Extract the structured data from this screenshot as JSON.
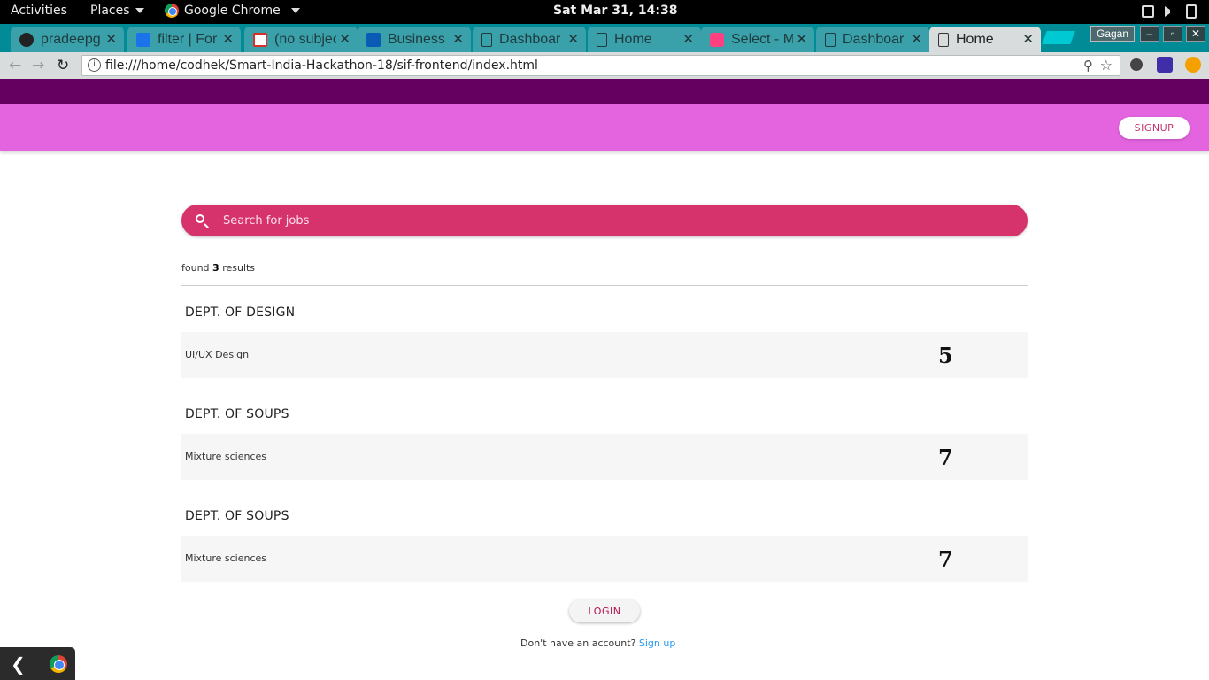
{
  "system_bar": {
    "activities": "Activities",
    "places": "Places",
    "app": "Google Chrome",
    "clock": "Sat Mar 31, 14:38"
  },
  "tabs": [
    {
      "title": "pradeepg",
      "icon": "github-icon"
    },
    {
      "title": "filter | For",
      "icon": "flag-icon"
    },
    {
      "title": "(no subjec",
      "icon": "gmail-icon"
    },
    {
      "title": "Business D",
      "icon": "is-icon"
    },
    {
      "title": "Dashboar",
      "icon": "page-icon"
    },
    {
      "title": "Home",
      "icon": "page-icon"
    },
    {
      "title": "Select - M",
      "icon": "material-icon"
    },
    {
      "title": "Dashboar",
      "icon": "page-icon"
    },
    {
      "title": "Home",
      "icon": "page-icon",
      "active": true
    }
  ],
  "profile": "Gagan",
  "address_bar": {
    "url": "file:///home/codhek/Smart-India-Hackathon-18/sif-frontend/index.html"
  },
  "header": {
    "signup_label": "SIGNUP"
  },
  "search": {
    "placeholder": "Search for jobs"
  },
  "results": {
    "prefix": "found",
    "count": "3",
    "suffix": "results"
  },
  "departments": [
    {
      "name": "DEPT. OF DESIGN",
      "job": "UI/UX Design",
      "count": "5"
    },
    {
      "name": "DEPT. OF SOUPS",
      "job": "Mixture sciences",
      "count": "7"
    },
    {
      "name": "DEPT. OF SOUPS",
      "job": "Mixture sciences",
      "count": "7"
    }
  ],
  "footer": {
    "login_label": "LOGIN",
    "account_text": "Don't have an account?",
    "signup_link": "Sign up"
  },
  "colors": {
    "header_dark": "#650060",
    "header_light": "#e464e0",
    "search_bg": "#d6336c",
    "link": "#2196f3"
  }
}
